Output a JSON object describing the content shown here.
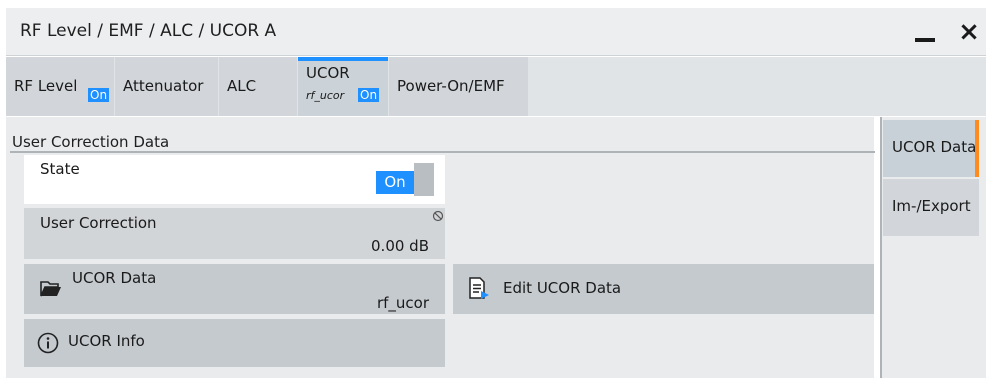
{
  "window": {
    "title": "RF Level / EMF / ALC / UCOR A"
  },
  "tabs": [
    {
      "label": "RF Level",
      "badge": "On"
    },
    {
      "label": "Attenuator"
    },
    {
      "label": "ALC"
    },
    {
      "label": "UCOR",
      "sub": "rf_ucor",
      "badge": "On",
      "selected": true
    },
    {
      "label": "Power-On/EMF"
    }
  ],
  "section": {
    "title": "User Correction Data"
  },
  "state": {
    "label": "State",
    "value": "On"
  },
  "user_correction": {
    "label": "User Correction",
    "value": "0.00 dB",
    "status_icon": "disabled-icon"
  },
  "ucor_data_button": {
    "label": "UCOR Data",
    "value": "rf_ucor",
    "icon": "folder-open-icon"
  },
  "edit_button": {
    "label": "Edit UCOR Data",
    "icon": "document-edit-icon"
  },
  "info_button": {
    "label": "UCOR Info",
    "icon": "info-icon"
  },
  "side_tabs": [
    {
      "label": "UCOR Data",
      "selected": true
    },
    {
      "label": "Im-/Export"
    }
  ],
  "colors": {
    "accent_on": "#1e90ff",
    "selected_side_tab": "#ff8a1e"
  }
}
